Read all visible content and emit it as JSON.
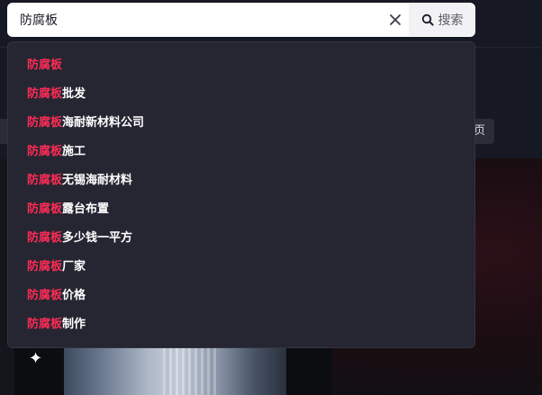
{
  "search": {
    "value": "防腐板",
    "button_label": "搜索"
  },
  "background": {
    "chip_label": "页"
  },
  "suggestions": {
    "keyword": "防腐板",
    "items": [
      {
        "rest": ""
      },
      {
        "rest": "批发"
      },
      {
        "rest": "海耐新材料公司"
      },
      {
        "rest": "施工"
      },
      {
        "rest": "无锡海耐材料"
      },
      {
        "rest": "露台布置"
      },
      {
        "rest": "多少钱一平方"
      },
      {
        "rest": "厂家"
      },
      {
        "rest": "价格"
      },
      {
        "rest": "制作"
      }
    ]
  },
  "colors": {
    "highlight": "#fe2c55",
    "panel_bg": "#252632",
    "page_bg": "#161823"
  },
  "icons": {
    "clear": "close-icon",
    "search": "search-icon",
    "sparkle": "sparkle-icon"
  }
}
